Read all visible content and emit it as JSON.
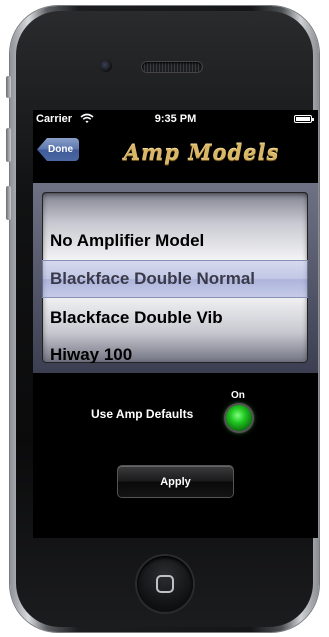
{
  "status_bar": {
    "carrier": "Carrier",
    "time": "9:35 PM"
  },
  "nav": {
    "done_label": "Done",
    "title": "Amp Models"
  },
  "picker": {
    "rows": [
      "No Amplifier Model",
      "Blackface Double Normal",
      "Blackface Double Vib",
      "Hiway 100"
    ],
    "selected_index": 1
  },
  "defaults": {
    "label": "Use Amp Defaults",
    "state_label": "On"
  },
  "apply": {
    "label": "Apply"
  },
  "colors": {
    "title_gold": "#d9b766",
    "done_blue": "#4b67a4",
    "led_green": "#20c620"
  }
}
